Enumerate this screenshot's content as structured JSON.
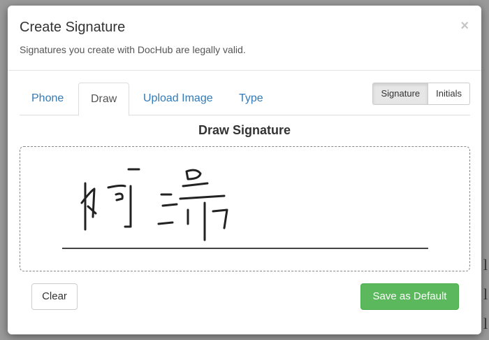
{
  "modal": {
    "title": "Create Signature",
    "subtitle": "Signatures you create with DocHub are legally valid.",
    "close_glyph": "×"
  },
  "tabs": [
    {
      "label": "Phone",
      "active": false
    },
    {
      "label": "Draw",
      "active": true
    },
    {
      "label": "Upload Image",
      "active": false
    },
    {
      "label": "Type",
      "active": false
    }
  ],
  "mode_toggle": {
    "signature_label": "Signature",
    "initials_label": "Initials",
    "selected": "Signature"
  },
  "draw": {
    "heading": "Draw Signature"
  },
  "buttons": {
    "clear_label": "Clear",
    "save_label": "Save as Default"
  },
  "colors": {
    "link": "#337ab7",
    "save_green": "#5cb85c",
    "ink": "#222222"
  },
  "icons": {
    "close": "close-icon"
  }
}
